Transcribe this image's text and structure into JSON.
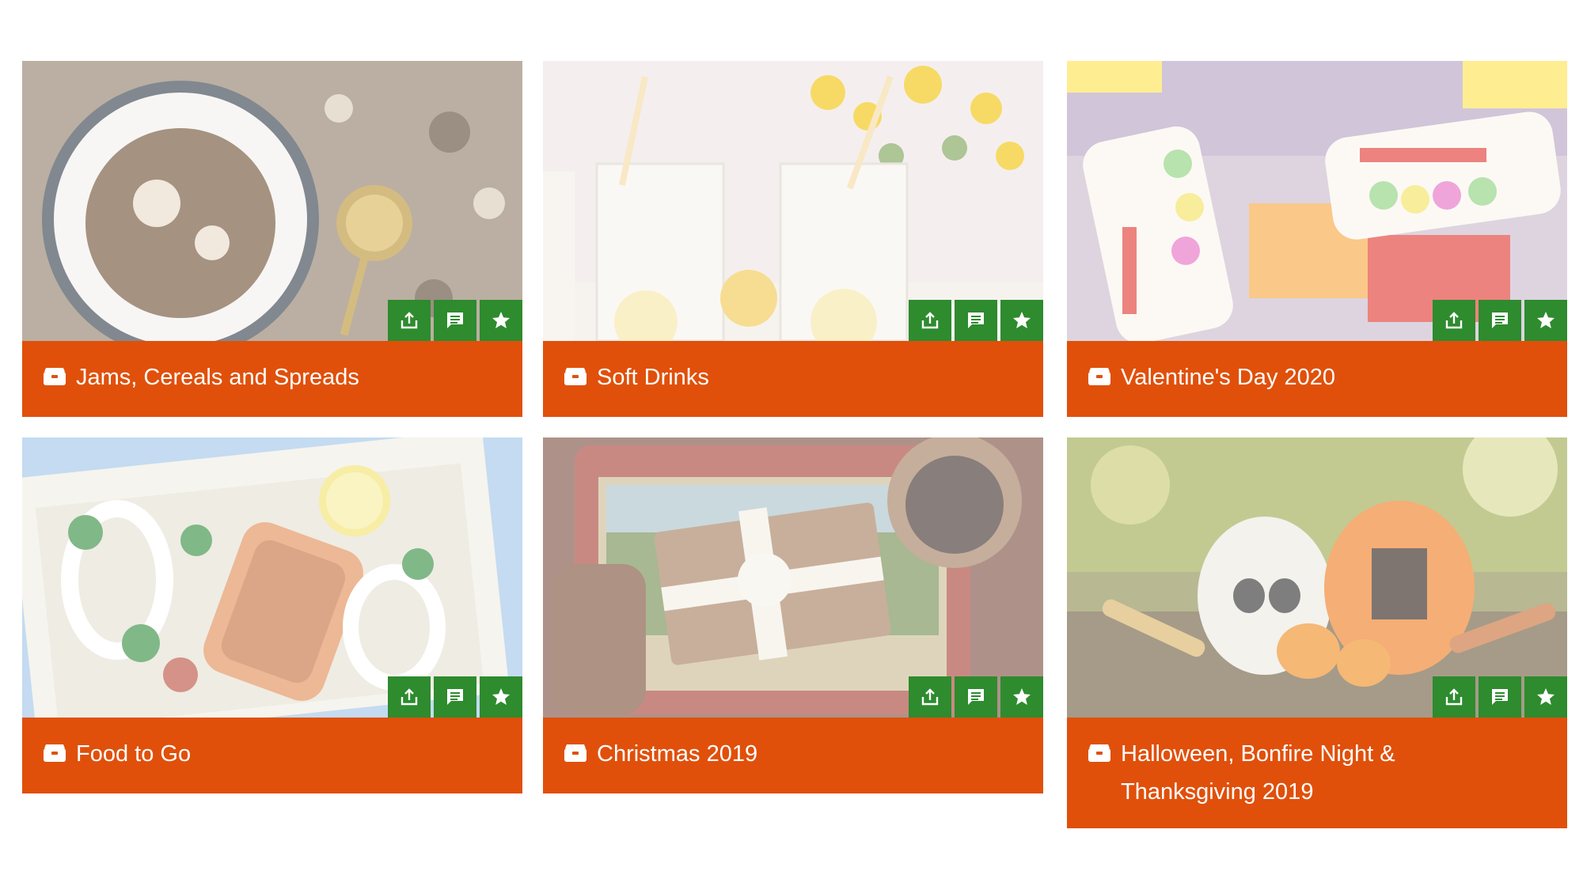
{
  "cards": [
    {
      "title": "Jams, Cereals and Spreads",
      "image": "granola-bowl-photo"
    },
    {
      "title": "Soft Drinks",
      "image": "lemonade-glasses-photo"
    },
    {
      "title": "Valentine's Day 2020",
      "image": "love-hearts-sweets-photo"
    },
    {
      "title": "Food to Go",
      "image": "salmon-salad-box-photo"
    },
    {
      "title": "Christmas 2019",
      "image": "gift-biscuit-tin-photo"
    },
    {
      "title": "Halloween, Bonfire Night & Thanksgiving 2019",
      "image": "painted-pumpkins-photo"
    }
  ],
  "icons": {
    "share": "share-icon",
    "comment": "comment-icon",
    "favourite": "star-icon",
    "category": "box-icon"
  },
  "colors": {
    "footer": "#e0500b",
    "action": "#2e8b2e",
    "text": "#ffffff"
  }
}
